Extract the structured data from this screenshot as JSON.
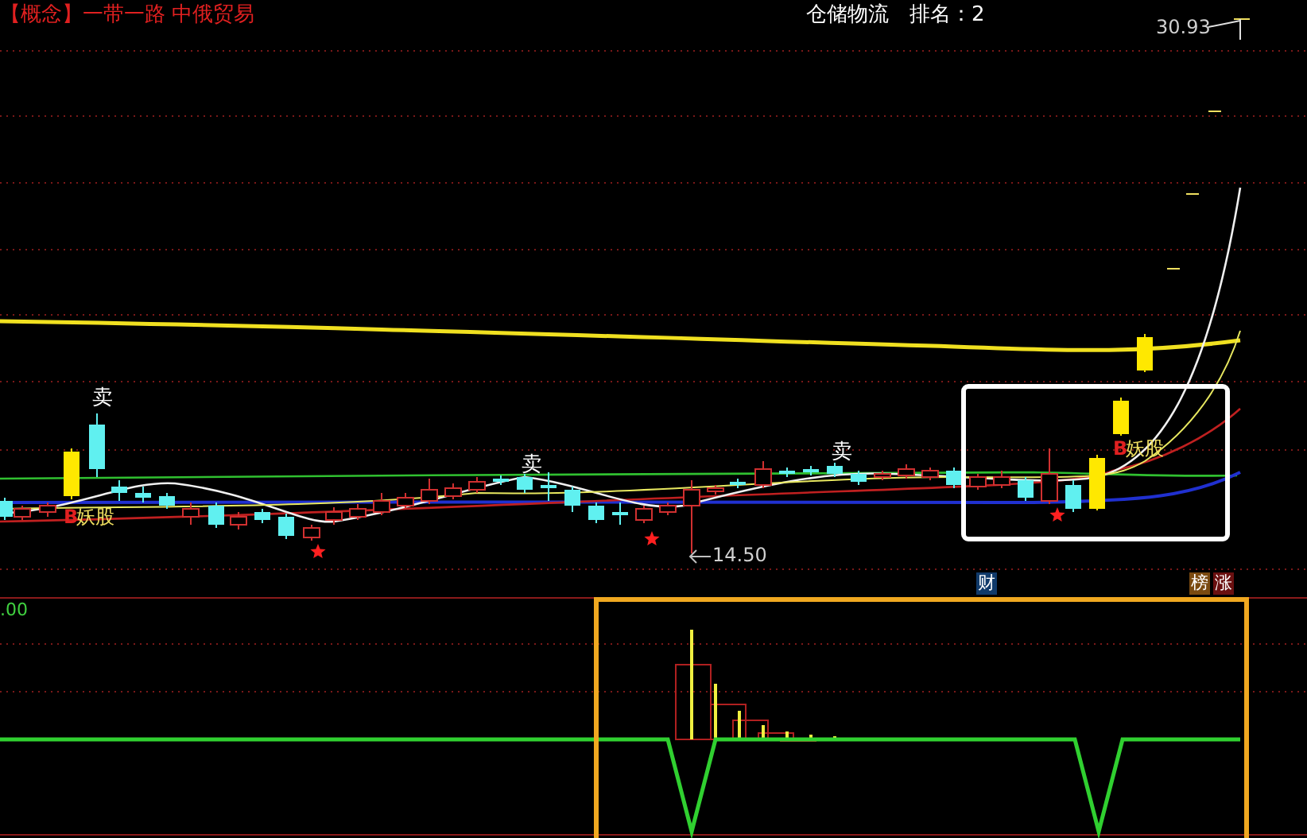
{
  "header": {
    "sector": "【概念】一带一路 中俄贸易",
    "stock": "仓储物流",
    "rank": "排名：2"
  },
  "price_labels": [
    {
      "kind": "high",
      "text": "30.93"
    },
    {
      "kind": "low",
      "text": "14.50"
    }
  ],
  "signals": [
    {
      "kind": "sell",
      "text": "卖"
    },
    {
      "kind": "sell",
      "text": "卖"
    },
    {
      "kind": "sell",
      "text": "卖"
    }
  ],
  "demon_labels": [
    {
      "letter": "B",
      "text": "妖股"
    },
    {
      "letter": "B",
      "text": "妖股"
    }
  ],
  "badges": [
    {
      "text": "财",
      "color": "#103a6a"
    },
    {
      "text": "榜",
      "color": "#7a4a10"
    },
    {
      "text": "涨",
      "color": "#6a1010"
    }
  ],
  "indicator": {
    "value": ".00"
  }
}
